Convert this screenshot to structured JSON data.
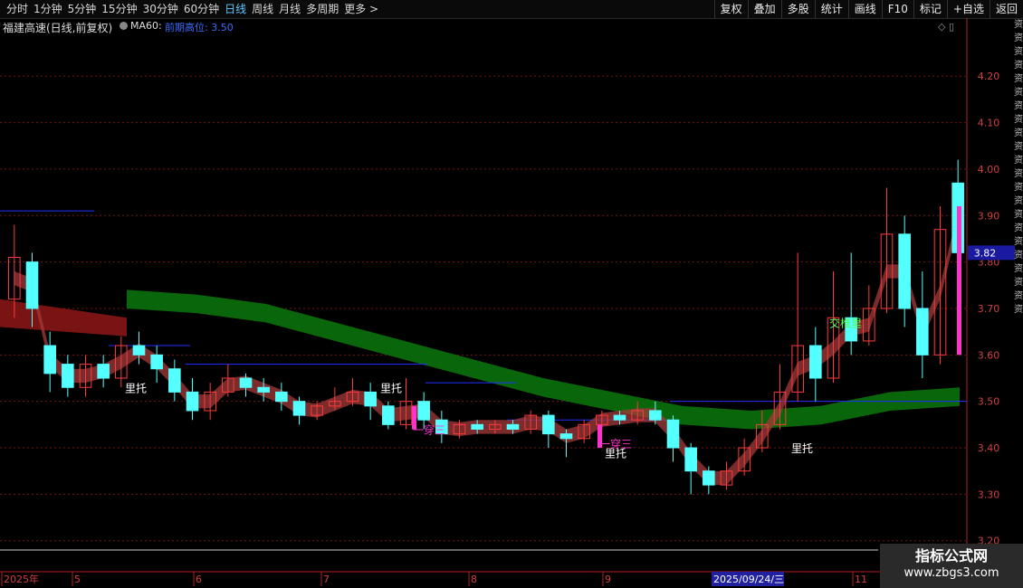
{
  "toolbar": {
    "periods": [
      "分时",
      "1分钟",
      "5分钟",
      "15分钟",
      "30分钟",
      "60分钟",
      "日线",
      "周线",
      "月线",
      "多周期",
      "更多 >"
    ],
    "active_period": "日线",
    "actions": [
      "复权",
      "叠加",
      "多股",
      "统计",
      "画线",
      "F10",
      "标记",
      "+自选",
      "返回"
    ]
  },
  "info": {
    "title": "福建高速(日线,前复权)",
    "ma": "MA60:",
    "legend_label": "前期高位:",
    "legend_value": "3.50"
  },
  "price_tag": "3.82",
  "colors": {
    "up": "#ff3a3a",
    "down": "#54ffff",
    "grid": "#7a1010",
    "ribbon_green": "#0b6b0b",
    "ribbon_red": "#7a1414",
    "level": "#2030ff",
    "magenta": "#ff33cc"
  },
  "watermark": {
    "line1": "指标公式网",
    "line2": "www.zbgs3.com"
  },
  "right_strip": "资资资资资资资资资资资资资资资资资资资资资资",
  "chart_data": {
    "type": "candlestick",
    "title": "福建高速(日线,前复权)",
    "y_ticks": [
      "4.20",
      "4.10",
      "4.00",
      "3.90",
      "3.80",
      "3.70",
      "3.60",
      "3.50",
      "3.40",
      "3.30",
      "3.20"
    ],
    "ylim": [
      3.18,
      4.29
    ],
    "x_labels": [
      "2025年",
      "5",
      "6",
      "7",
      "8",
      "9",
      "2025/09/24/三",
      "11"
    ],
    "last_price": 3.82,
    "annotations": [
      "里托",
      "里托",
      "里托",
      "一穿三",
      "一穿三",
      "里托",
      "里托",
      "交椎里"
    ],
    "ma60_ribbon_values": [
      3.72,
      3.71,
      3.69,
      3.65,
      3.61,
      3.57,
      3.53,
      3.5,
      3.47,
      3.46,
      3.47,
      3.5,
      3.51
    ],
    "level_lines": [
      3.91,
      3.62,
      3.58,
      3.54,
      3.46,
      3.5
    ],
    "candles": [
      {
        "o": 3.72,
        "c": 3.81,
        "h": 3.88,
        "l": 3.68
      },
      {
        "o": 3.8,
        "c": 3.7,
        "h": 3.82,
        "l": 3.66
      },
      {
        "o": 3.62,
        "c": 3.56,
        "h": 3.65,
        "l": 3.52
      },
      {
        "o": 3.58,
        "c": 3.53,
        "h": 3.6,
        "l": 3.51
      },
      {
        "o": 3.53,
        "c": 3.58,
        "h": 3.6,
        "l": 3.51
      },
      {
        "o": 3.58,
        "c": 3.55,
        "h": 3.6,
        "l": 3.53
      },
      {
        "o": 3.55,
        "c": 3.62,
        "h": 3.64,
        "l": 3.53
      },
      {
        "o": 3.62,
        "c": 3.6,
        "h": 3.65,
        "l": 3.58
      },
      {
        "o": 3.6,
        "c": 3.57,
        "h": 3.62,
        "l": 3.54
      },
      {
        "o": 3.57,
        "c": 3.52,
        "h": 3.59,
        "l": 3.5
      },
      {
        "o": 3.52,
        "c": 3.48,
        "h": 3.55,
        "l": 3.46
      },
      {
        "o": 3.48,
        "c": 3.52,
        "h": 3.54,
        "l": 3.46
      },
      {
        "o": 3.52,
        "c": 3.55,
        "h": 3.58,
        "l": 3.51
      },
      {
        "o": 3.55,
        "c": 3.53,
        "h": 3.56,
        "l": 3.51
      },
      {
        "o": 3.53,
        "c": 3.52,
        "h": 3.55,
        "l": 3.5
      },
      {
        "o": 3.52,
        "c": 3.5,
        "h": 3.54,
        "l": 3.48
      },
      {
        "o": 3.5,
        "c": 3.47,
        "h": 3.51,
        "l": 3.45
      },
      {
        "o": 3.47,
        "c": 3.49,
        "h": 3.5,
        "l": 3.46
      },
      {
        "o": 3.49,
        "c": 3.5,
        "h": 3.53,
        "l": 3.48
      },
      {
        "o": 3.5,
        "c": 3.52,
        "h": 3.55,
        "l": 3.49
      },
      {
        "o": 3.52,
        "c": 3.49,
        "h": 3.54,
        "l": 3.46
      },
      {
        "o": 3.49,
        "c": 3.45,
        "h": 3.5,
        "l": 3.44
      },
      {
        "o": 3.45,
        "c": 3.5,
        "h": 3.55,
        "l": 3.44
      },
      {
        "o": 3.5,
        "c": 3.46,
        "h": 3.52,
        "l": 3.44
      },
      {
        "o": 3.46,
        "c": 3.43,
        "h": 3.48,
        "l": 3.41
      },
      {
        "o": 3.43,
        "c": 3.45,
        "h": 3.46,
        "l": 3.42
      },
      {
        "o": 3.45,
        "c": 3.44,
        "h": 3.46,
        "l": 3.43
      },
      {
        "o": 3.44,
        "c": 3.45,
        "h": 3.46,
        "l": 3.43
      },
      {
        "o": 3.45,
        "c": 3.44,
        "h": 3.46,
        "l": 3.43
      },
      {
        "o": 3.44,
        "c": 3.47,
        "h": 3.48,
        "l": 3.43
      },
      {
        "o": 3.47,
        "c": 3.43,
        "h": 3.48,
        "l": 3.4
      },
      {
        "o": 3.43,
        "c": 3.42,
        "h": 3.44,
        "l": 3.38
      },
      {
        "o": 3.42,
        "c": 3.45,
        "h": 3.46,
        "l": 3.41
      },
      {
        "o": 3.45,
        "c": 3.47,
        "h": 3.48,
        "l": 3.44
      },
      {
        "o": 3.47,
        "c": 3.46,
        "h": 3.48,
        "l": 3.45
      },
      {
        "o": 3.46,
        "c": 3.48,
        "h": 3.5,
        "l": 3.45
      },
      {
        "o": 3.48,
        "c": 3.46,
        "h": 3.5,
        "l": 3.45
      },
      {
        "o": 3.46,
        "c": 3.4,
        "h": 3.47,
        "l": 3.37
      },
      {
        "o": 3.4,
        "c": 3.35,
        "h": 3.41,
        "l": 3.3
      },
      {
        "o": 3.35,
        "c": 3.32,
        "h": 3.36,
        "l": 3.3
      },
      {
        "o": 3.32,
        "c": 3.35,
        "h": 3.37,
        "l": 3.31
      },
      {
        "o": 3.35,
        "c": 3.4,
        "h": 3.42,
        "l": 3.34
      },
      {
        "o": 3.4,
        "c": 3.45,
        "h": 3.48,
        "l": 3.39
      },
      {
        "o": 3.45,
        "c": 3.52,
        "h": 3.58,
        "l": 3.44
      },
      {
        "o": 3.52,
        "c": 3.62,
        "h": 3.82,
        "l": 3.5
      },
      {
        "o": 3.62,
        "c": 3.55,
        "h": 3.66,
        "l": 3.5
      },
      {
        "o": 3.55,
        "c": 3.68,
        "h": 3.78,
        "l": 3.54
      },
      {
        "o": 3.68,
        "c": 3.63,
        "h": 3.82,
        "l": 3.6
      },
      {
        "o": 3.63,
        "c": 3.7,
        "h": 3.75,
        "l": 3.62
      },
      {
        "o": 3.7,
        "c": 3.86,
        "h": 3.96,
        "l": 3.69
      },
      {
        "o": 3.86,
        "c": 3.7,
        "h": 3.9,
        "l": 3.66
      },
      {
        "o": 3.7,
        "c": 3.6,
        "h": 3.78,
        "l": 3.55
      },
      {
        "o": 3.6,
        "c": 3.87,
        "h": 3.92,
        "l": 3.58
      },
      {
        "o": 3.97,
        "c": 3.82,
        "h": 4.02,
        "l": 3.8
      }
    ]
  }
}
